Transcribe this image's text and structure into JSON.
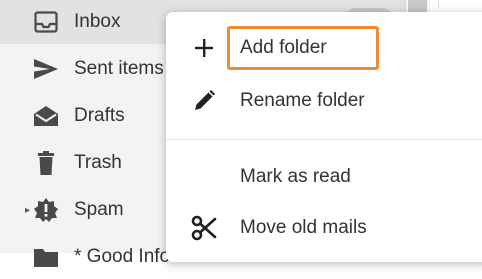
{
  "sidebar": {
    "folders": [
      {
        "label": "Inbox",
        "icon": "inbox-icon",
        "selected": true
      },
      {
        "label": "Sent items",
        "icon": "send-icon"
      },
      {
        "label": "Drafts",
        "icon": "drafts-icon"
      },
      {
        "label": "Trash",
        "icon": "trash-icon"
      },
      {
        "label": "Spam",
        "icon": "spam-icon",
        "expandable": true
      },
      {
        "label": "* Good Info",
        "icon": "folder-icon"
      }
    ]
  },
  "context_menu": {
    "items": [
      {
        "label": "Add folder",
        "icon": "plus-icon",
        "highlighted": true
      },
      {
        "label": "Rename folder",
        "icon": "pencil-icon"
      },
      {
        "label": "Mark as read",
        "icon": ""
      },
      {
        "label": "Move old mails",
        "icon": "scissors-icon"
      }
    ]
  },
  "colors": {
    "highlight": "#ec8c35",
    "selected_bg": "#e2e2e2",
    "sidebar_bg": "#f3f3f3"
  }
}
